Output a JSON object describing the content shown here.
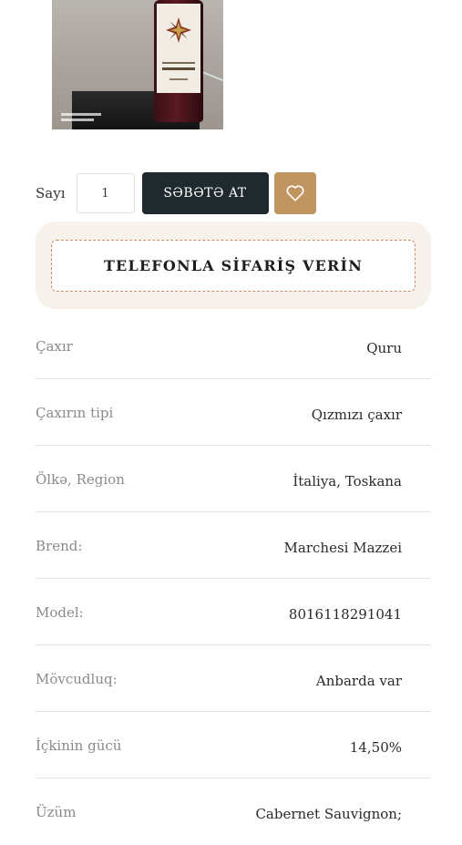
{
  "product": {
    "image_alt": "wine-bottle-photo"
  },
  "quantity": {
    "label": "Sayı",
    "value": "1"
  },
  "buttons": {
    "add_to_cart": "SƏBƏTƏ AT",
    "wishlist_icon": "heart-icon",
    "phone_order": "TELEFONLA SİFARİŞ VERİN"
  },
  "colors": {
    "cart_button": "#1f2a2e",
    "wishlist_button": "#c09560",
    "phone_box_bg": "#f7f2ec",
    "phone_border": "#c98b6a"
  },
  "specs": [
    {
      "key": "Çaxır",
      "value": "Quru"
    },
    {
      "key": "Çaxırın tipi",
      "value": "Qızmızı çaxır"
    },
    {
      "key": "Ölkə, Region",
      "value": "İtaliya, Toskana"
    },
    {
      "key": "Brend:",
      "value": "Marchesi Mazzei"
    },
    {
      "key": "Model:",
      "value": "8016118291041"
    },
    {
      "key": "Mövcudluq:",
      "value": "Anbarda var"
    },
    {
      "key": "İçkinin gücü",
      "value": "14,50%"
    },
    {
      "key": "Üzüm",
      "value": "Cabernet Sauvignon;"
    }
  ]
}
